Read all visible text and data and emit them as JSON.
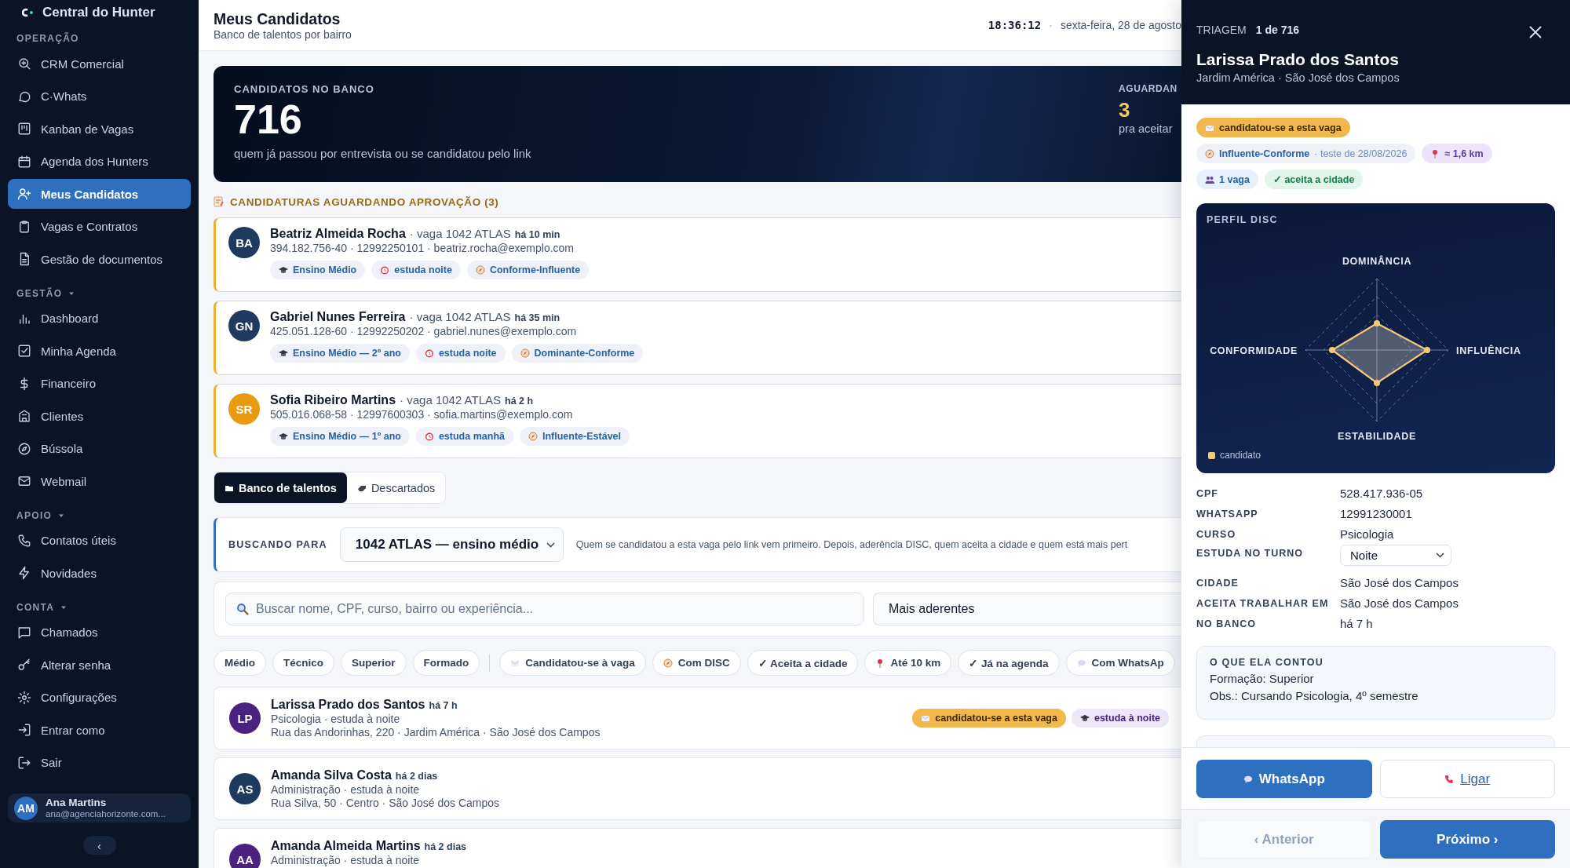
{
  "sidebar": {
    "brand": "Central do Hunter",
    "sections": [
      {
        "label": "OPERAÇÃO",
        "collapsible": false,
        "items": [
          {
            "label": "CRM Comercial",
            "selected": false
          },
          {
            "label": "C·Whats",
            "selected": false
          },
          {
            "label": "Kanban de Vagas",
            "selected": false
          },
          {
            "label": "Agenda dos Hunters",
            "selected": false
          },
          {
            "label": "Meus Candidatos",
            "selected": true
          },
          {
            "label": "Vagas e Contratos",
            "selected": false
          },
          {
            "label": "Gestão de documentos",
            "selected": false
          }
        ]
      },
      {
        "label": "GESTÃO",
        "collapsible": true,
        "items": [
          {
            "label": "Dashboard",
            "selected": false
          },
          {
            "label": "Minha Agenda",
            "selected": false
          },
          {
            "label": "Financeiro",
            "selected": false
          },
          {
            "label": "Clientes",
            "selected": false
          },
          {
            "label": "Bússola",
            "selected": false
          },
          {
            "label": "Webmail",
            "selected": false
          }
        ]
      },
      {
        "label": "APOIO",
        "collapsible": true,
        "items": [
          {
            "label": "Contatos úteis",
            "selected": false
          },
          {
            "label": "Novidades",
            "selected": false
          }
        ]
      },
      {
        "label": "CONTA",
        "collapsible": true,
        "items": [
          {
            "label": "Chamados",
            "selected": false
          },
          {
            "label": "Alterar senha",
            "selected": false
          },
          {
            "label": "Configurações",
            "selected": false
          },
          {
            "label": "Entrar como",
            "selected": false
          },
          {
            "label": "Sair",
            "selected": false
          }
        ]
      }
    ],
    "user": {
      "initials": "AM",
      "name": "Ana Martins",
      "email": "ana@agenciahorizonte.com..."
    },
    "collapse": "‹"
  },
  "header": {
    "title": "Meus Candidatos",
    "subtitle": "Banco de talentos por bairro",
    "clock": "18:36:12",
    "separator": "·",
    "date": "sexta-feira, 28 de agosto"
  },
  "hero": {
    "label": "CANDIDATOS NO BANCO",
    "value": "716",
    "caption": "quem já passou por entrevista ou se candidatou pelo link",
    "side_label": "AGUARDAN",
    "side_value": "3",
    "side_caption": "pra aceitar"
  },
  "pending": {
    "title": "CANDIDATURAS AGUARDANDO APROVAÇÃO (3)",
    "items": [
      {
        "initials": "BA",
        "color": "#1e3a5f",
        "name": "Beatriz Almeida Rocha",
        "job": "· vaga 1042 ATLAS",
        "time": "há 10 min",
        "contact": "394.182.756-40 · 12992250101 · beatriz.rocha@exemplo.com",
        "tags": [
          {
            "kind": "education",
            "label": "Ensino Médio"
          },
          {
            "kind": "shift",
            "label": "estuda noite"
          },
          {
            "kind": "disc",
            "label": "Conforme-Influente"
          }
        ]
      },
      {
        "initials": "GN",
        "color": "#1e3a5f",
        "name": "Gabriel Nunes Ferreira",
        "job": "· vaga 1042 ATLAS",
        "time": "há 35 min",
        "contact": "425.051.128-60 · 12992250202 · gabriel.nunes@exemplo.com",
        "tags": [
          {
            "kind": "education",
            "label": "Ensino Médio — 2º ano"
          },
          {
            "kind": "shift",
            "label": "estuda noite"
          },
          {
            "kind": "disc",
            "label": "Dominante-Conforme"
          }
        ]
      },
      {
        "initials": "SR",
        "color": "#e89a10",
        "name": "Sofia Ribeiro Martins",
        "job": "· vaga 1042 ATLAS",
        "time": "há 2 h",
        "contact": "505.016.068-58 · 12997600303 · sofia.martins@exemplo.com",
        "tags": [
          {
            "kind": "education",
            "label": "Ensino Médio — 1º ano"
          },
          {
            "kind": "shift",
            "label": "estuda manhã"
          },
          {
            "kind": "disc",
            "label": "Influente-Estável"
          }
        ]
      }
    ]
  },
  "tabs": [
    {
      "label": "Banco de talentos",
      "selected": true
    },
    {
      "label": "Descartados",
      "selected": false
    }
  ],
  "target": {
    "label": "BUSCANDO PARA",
    "value": "1042 ATLAS — ensino médio",
    "hint": "Quem se candidatou a esta vaga pelo link vem primeiro. Depois, aderência DISC, quem aceita a cidade e quem está mais pert"
  },
  "search": {
    "placeholder": "Buscar nome, CPF, curso, bairro ou experiência...",
    "sort": "Mais aderentes"
  },
  "filters": [
    {
      "kind": "level",
      "label": "Médio",
      "selected": false
    },
    {
      "kind": "level",
      "label": "Técnico",
      "selected": false
    },
    {
      "kind": "level",
      "label": "Superior",
      "selected": false
    },
    {
      "kind": "level",
      "label": "Formado",
      "selected": false
    },
    {
      "kind": "applied",
      "label": "Candidatou-se à vaga",
      "selected": false
    },
    {
      "kind": "disc",
      "label": "Com DISC",
      "selected": false
    },
    {
      "kind": "check",
      "label": "✓ Aceita a cidade",
      "selected": false
    },
    {
      "kind": "distance",
      "label": "Até 10 km",
      "selected": false
    },
    {
      "kind": "check",
      "label": "✓ Já na agenda",
      "selected": false
    },
    {
      "kind": "whatsapp",
      "label": "Com WhatsAp",
      "selected": false
    }
  ],
  "candidates": [
    {
      "initials": "LP",
      "color": "#4a2380",
      "name": "Larissa Prado dos Santos",
      "time": "há 7 h",
      "info": "Psicologia · estuda à noite",
      "address": "Rua das Andorinhas, 220 · Jardim América · São José dos Campos",
      "tags": [
        {
          "kind": "applied",
          "label": "candidatou-se a esta vaga"
        },
        {
          "kind": "shift",
          "label": "estuda à noite"
        }
      ]
    },
    {
      "initials": "AS",
      "color": "#1e3a5f",
      "name": "Amanda Silva Costa",
      "time": "há 2 dias",
      "info": "Administração · estuda à noite",
      "address": "Rua Silva, 50 · Centro · São José dos Campos"
    },
    {
      "initials": "AA",
      "color": "#4a2380",
      "name": "Amanda Almeida Martins",
      "time": "há 2 dias",
      "info": "Administração · estuda à noite"
    }
  ],
  "drawer": {
    "label": "TRIAGEM",
    "position": "1 de 716",
    "name": "Larissa Prado dos Santos",
    "location": "Jardim América · São José dos Campos",
    "chips": [
      [
        {
          "kind": "applied",
          "label": "candidatou-se a esta vaga"
        }
      ],
      [
        {
          "kind": "disc",
          "label": "Influente-Conforme",
          "note": "· teste de 28/08/2026"
        },
        {
          "kind": "distance",
          "label": "≈ 1,6 km"
        }
      ],
      [
        {
          "kind": "vacancy",
          "label": "1 vaga"
        },
        {
          "kind": "accepts",
          "label": "✓ aceita a cidade"
        }
      ]
    ],
    "disc": {
      "title": "PERFIL DISC",
      "axes": [
        "DOMINÂNCIA",
        "INFLUÊNCIA",
        "ESTABILIDADE",
        "CONFORMIDADE"
      ],
      "legend": "candidato"
    },
    "details": [
      {
        "kind": "text",
        "label": "CPF",
        "value": "528.417.936-05"
      },
      {
        "kind": "text",
        "label": "WHATSAPP",
        "value": "12991230001"
      },
      {
        "kind": "text",
        "label": "CURSO",
        "value": "Psicologia"
      },
      {
        "kind": "select",
        "label": "ESTUDA NO TURNO",
        "value": "Noite"
      },
      {
        "kind": "text",
        "label": "CIDADE",
        "value": "São José dos Campos"
      },
      {
        "kind": "text",
        "label": "ACEITA TRABALHAR EM",
        "value": "São José dos Campos"
      },
      {
        "kind": "text",
        "label": "NO BANCO",
        "value": "há 7 h"
      }
    ],
    "notes": {
      "title": "O QUE ELA CONTOU",
      "lines": [
        "Formação: Superior",
        "Obs.: Cursando Psicologia, 4º semestre"
      ]
    },
    "actions": [
      {
        "kind": "whatsapp",
        "label": "WhatsApp"
      },
      {
        "kind": "call",
        "label": "Ligar"
      }
    ],
    "nav": [
      {
        "label": "‹ Anterior",
        "disabled": true
      },
      {
        "label": "Próximo ›",
        "disabled": false
      }
    ]
  }
}
